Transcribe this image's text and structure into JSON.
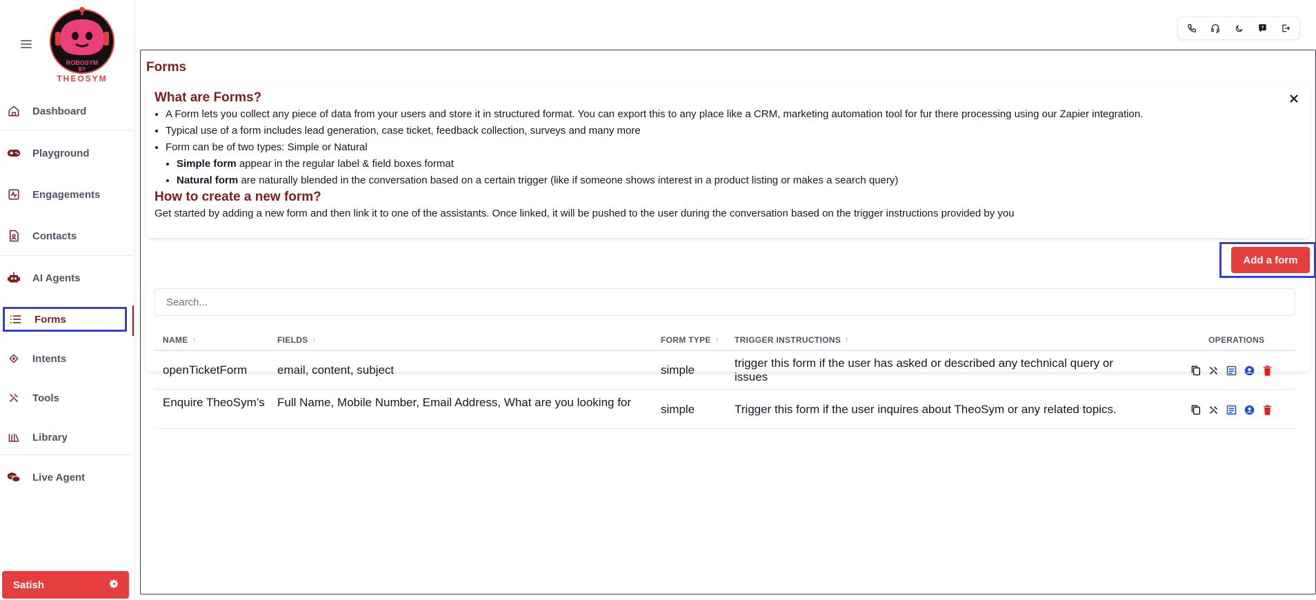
{
  "brand": {
    "logo_line1": "ROBOSYM",
    "logo_line2": "BY",
    "logo_line3": "THEOSYM",
    "accent": "#e53e3e",
    "dark_red": "#7f1d1d"
  },
  "sidebar": {
    "items": [
      {
        "label": "Dashboard",
        "icon": "home-icon"
      },
      {
        "label": "Playground",
        "icon": "gamepad-icon"
      },
      {
        "label": "Engagements",
        "icon": "activity-icon"
      },
      {
        "label": "Contacts",
        "icon": "contact-file-icon"
      },
      {
        "label": "AI Agents",
        "icon": "robot-icon"
      },
      {
        "label": "Forms",
        "icon": "list-icon"
      },
      {
        "label": "Intents",
        "icon": "diamond-icon"
      },
      {
        "label": "Tools",
        "icon": "tools-icon"
      },
      {
        "label": "Library",
        "icon": "library-icon"
      },
      {
        "label": "Live Agent",
        "icon": "chat-icon"
      }
    ],
    "active": "Forms",
    "user_name": "Satish"
  },
  "toolbar": {
    "icons": [
      "phone-icon",
      "headset-icon",
      "moon-icon",
      "help-icon",
      "logout-icon"
    ]
  },
  "page": {
    "title": "Forms"
  },
  "info": {
    "heading1": "What are Forms?",
    "bullet1": "A Form lets you collect any piece of data from your users and store it in structured format. You can export this to any place like a CRM, marketing automation tool for fur there processing using our Zapier integration.",
    "bullet2": "Typical use of a form includes lead generation, case ticket, feedback collection, surveys and many more",
    "bullet3": "Form can be of two types: Simple or Natural",
    "sub1_bold": "Simple form",
    "sub1_text": " appear in the regular label & field boxes format",
    "sub2_bold": "Natural form",
    "sub2_text": " are naturally blended in the conversation based on a certain trigger (like if someone shows interest in a product listing or makes a search query)",
    "heading2": "How to create a new form?",
    "paragraph": "Get started by adding a new form and then link it to one of the assistants. Once linked, it will be pushed to the user during the conversation based on the trigger instructions provided by you"
  },
  "actions": {
    "add_form": "Add a form"
  },
  "search": {
    "placeholder": "Search..."
  },
  "table": {
    "headers": {
      "name": "NAME",
      "fields": "FIELDS",
      "form_type": "FORM TYPE",
      "trigger": "TRIGGER INSTRUCTIONS",
      "operations": "OPERATIONS"
    },
    "sort_glyph": "↑",
    "rows": [
      {
        "name": "openTicketForm",
        "fields": "email, content, subject",
        "form_type": "simple",
        "trigger": "trigger this form if the user has asked or described any technical query or issues"
      },
      {
        "name": "Enquire TheoSym’s",
        "fields": "Full Name, Mobile Number, Email Address, What are you looking for",
        "form_type": "simple",
        "trigger": "Trigger this form if the user inquires about TheoSym or any related topics."
      }
    ],
    "operation_icons": [
      "copy-icon",
      "tools-icon",
      "form-icon",
      "user-circle-icon",
      "trash-icon"
    ]
  }
}
